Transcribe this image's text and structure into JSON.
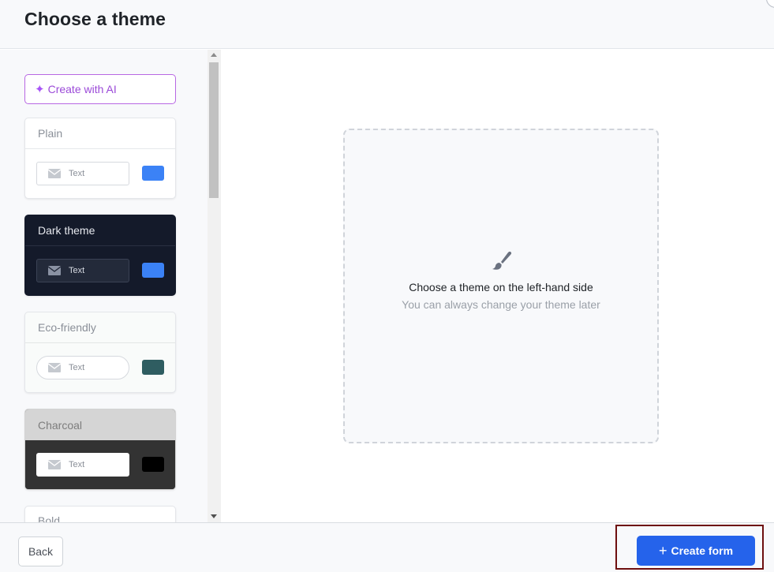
{
  "header": {
    "title": "Choose a theme"
  },
  "sidebar": {
    "ai_button_label": "Create with AI",
    "themes": [
      {
        "name": "Plain",
        "input_text": "Text",
        "swatch_color": "#3b82f6"
      },
      {
        "name": "Dark theme",
        "input_text": "Text",
        "swatch_color": "#3b82f6"
      },
      {
        "name": "Eco-friendly",
        "input_text": "Text",
        "swatch_color": "#2f5d61"
      },
      {
        "name": "Charcoal",
        "input_text": "Text",
        "swatch_color": "#000000"
      },
      {
        "name": "Bold"
      }
    ]
  },
  "preview": {
    "icon": "paint-brush-icon",
    "primary_text": "Choose a theme on the left-hand side",
    "secondary_text": "You can always change your theme later"
  },
  "footer": {
    "back_label": "Back",
    "create_label": "Create form",
    "create_icon": "plus-icon",
    "accent_color": "#2563eb"
  }
}
